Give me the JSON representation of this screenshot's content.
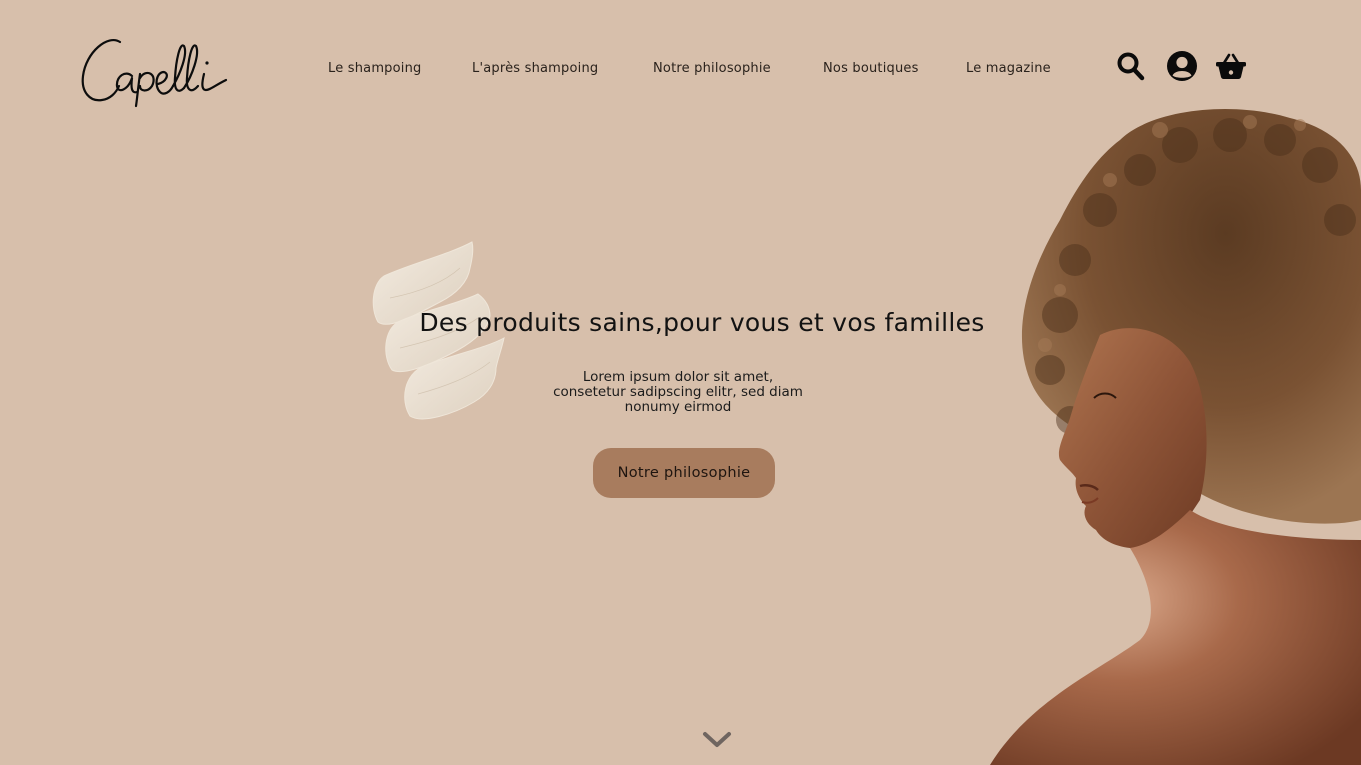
{
  "brand": {
    "logo_text": "Capelli"
  },
  "nav": {
    "items": [
      {
        "label": "Le shampoing"
      },
      {
        "label": "L'après shampoing"
      },
      {
        "label": "Notre philosophie"
      },
      {
        "label": "Nos boutiques"
      },
      {
        "label": "Le magazine"
      }
    ]
  },
  "header_icons": {
    "search": "search-icon",
    "account": "user-account-icon",
    "cart": "shopping-basket-icon"
  },
  "hero": {
    "title": "Des produits sains,pour vous et vos familles",
    "text": "Lorem ipsum dolor sit amet, consetetur sadipscing elitr, sed diam nonumy eirmod",
    "cta_label": "Notre philosophie"
  },
  "scroll": {
    "icon": "chevron-down-icon"
  },
  "colors": {
    "background": "#d7bfab",
    "cta": "#a87c5e",
    "text": "#111111",
    "icon": "#0b0b0b",
    "scroll_chevron": "#6f6560",
    "swatch": "#ede2d3"
  }
}
